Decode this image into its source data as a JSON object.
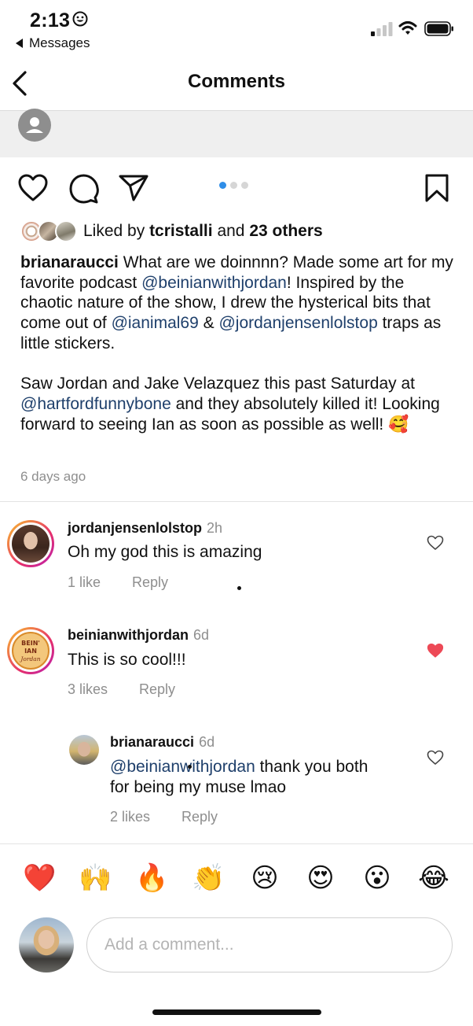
{
  "status_bar": {
    "time": "2:13",
    "back_app": "Messages"
  },
  "header": {
    "title": "Comments"
  },
  "post": {
    "liked_by_prefix": "Liked by ",
    "liked_by_user": "tcristalli",
    "liked_by_and": " and ",
    "liked_by_others": "23 others",
    "caption": {
      "username": "brianaraucci",
      "p1_a": " What are we doinnnn? Made some art for my favorite podcast ",
      "m1": "@beinianwithjordan",
      "p1_b": "! Inspired by the chaotic nature of the show, I drew the hysterical bits that come out of ",
      "m2": "@ianimal69",
      "p1_c": " & ",
      "m3": "@jordanjensenlolstop",
      "p1_d": " traps as little stickers.",
      "p2_a": "Saw Jordan and Jake Velazquez this past Saturday at ",
      "m4": "@hartfordfunnybone",
      "p2_b": " and they absolutely killed it! Looking forward to seeing Ian as soon as possible as well! ",
      "emoji": "🥰"
    },
    "time_ago": "6 days ago"
  },
  "comments": [
    {
      "username": "jordanjensenlolstop",
      "time": "2h",
      "text": "Oh my god this is amazing",
      "likes": "1 like",
      "reply": "Reply",
      "liked": false
    },
    {
      "username": "beinianwithjordan",
      "time": "6d",
      "text": "This is so cool!!!",
      "likes": "3 likes",
      "reply": "Reply",
      "liked": true,
      "avatar_text": [
        "BEIN'",
        "IAN",
        "Jordan"
      ]
    },
    {
      "username": "brianaraucci",
      "time": "6d",
      "mention": "@beinianwithjordan",
      "text_line1_rest": " thank you both",
      "text_line2": "for being my muse lmao",
      "likes": "2 likes",
      "reply": "Reply",
      "liked": false,
      "is_reply": true
    }
  ],
  "reactions": [
    "❤️",
    "🙌",
    "🔥",
    "👏",
    "😢",
    "😍",
    "😮",
    "😂"
  ],
  "composer": {
    "placeholder": "Add a comment..."
  },
  "colors": {
    "mention": "#1e3f6b",
    "like_red": "#ed4956",
    "dot_active": "#2f8ee8",
    "meta_gray": "#8e8e8e"
  },
  "icons": [
    "smiley-icon",
    "signal-icon",
    "wifi-icon",
    "battery-icon",
    "back-chevron-icon",
    "person-icon",
    "heart-icon",
    "comment-icon",
    "share-icon",
    "bookmark-icon"
  ]
}
